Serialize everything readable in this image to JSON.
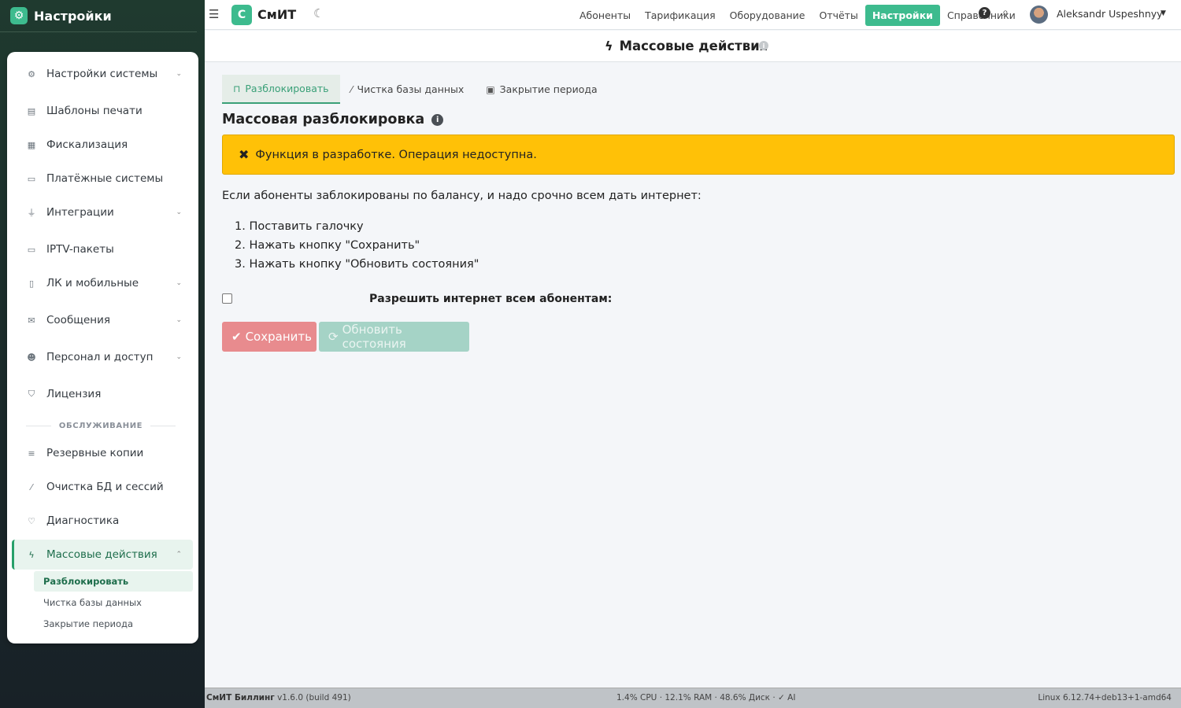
{
  "sidebar": {
    "brand": "Настройки",
    "items": [
      {
        "label": "Настройки системы",
        "icon": "cogs-icon"
      },
      {
        "label": "Шаблоны печати",
        "icon": "printer-icon"
      },
      {
        "label": "Фискализация",
        "icon": "cash-register-icon"
      },
      {
        "label": "Платёжные системы",
        "icon": "credit-card-icon"
      },
      {
        "label": "Интеграции",
        "icon": "plug-icon"
      },
      {
        "label": "IPTV-пакеты",
        "icon": "tv-icon"
      },
      {
        "label": "ЛК и мобильные",
        "icon": "mobile-icon"
      },
      {
        "label": "Сообщения",
        "icon": "envelope-icon"
      },
      {
        "label": "Персонал и доступ",
        "icon": "users-icon"
      },
      {
        "label": "Лицензия",
        "icon": "shield-icon"
      }
    ],
    "section_label": "ОБСЛУЖИВАНИЕ",
    "service_items": [
      {
        "label": "Резервные копии",
        "icon": "database-icon"
      },
      {
        "label": "Очистка БД и сессий",
        "icon": "broom-icon"
      },
      {
        "label": "Диагностика",
        "icon": "stethoscope-icon"
      },
      {
        "label": "Массовые действия",
        "icon": "bolt-icon"
      }
    ],
    "sub_items": [
      "Разблокировать",
      "Чистка базы данных",
      "Закрытие периода"
    ]
  },
  "topnav": {
    "logo_letter": "С",
    "logo_text": "СмИТ",
    "links": [
      "Абоненты",
      "Тарификация",
      "Оборудование",
      "Отчёты",
      "Настройки",
      "Справочники"
    ],
    "active_link": "Настройки",
    "user_name": "Aleksandr Uspeshnyy"
  },
  "page": {
    "title": "Массовые действия"
  },
  "tabs": [
    "Разблокировать",
    "Чистка базы данных",
    "Закрытие периода"
  ],
  "main": {
    "heading": "Массовая разблокировка",
    "alert": "Функция в разработке. Операция недоступна.",
    "description": "Если абоненты заблокированы по балансу, и надо срочно всем дать интернет:",
    "steps": [
      "1. Поставить галочку",
      "2. Нажать кнопку \"Сохранить\"",
      "3. Нажать кнопку \"Обновить состояния\""
    ],
    "checkbox_label": "Разрешить интернет всем абонентам:",
    "save_button": "Сохранить",
    "refresh_button": "Обновить состояния"
  },
  "footer": {
    "app_name": "СмИТ Биллинг",
    "version": "v1.6.0 (build 491)",
    "stats": "1.4% CPU · 12.1% RAM · 48.6% Диск · ✓ AI",
    "os": "Linux 6.12.74+deb13+1-amd64"
  },
  "colors": {
    "accent": "#3dbb8e",
    "alert": "#ffc107",
    "save_button": "#e88b8e",
    "refresh_button": "#a5d3c6"
  }
}
